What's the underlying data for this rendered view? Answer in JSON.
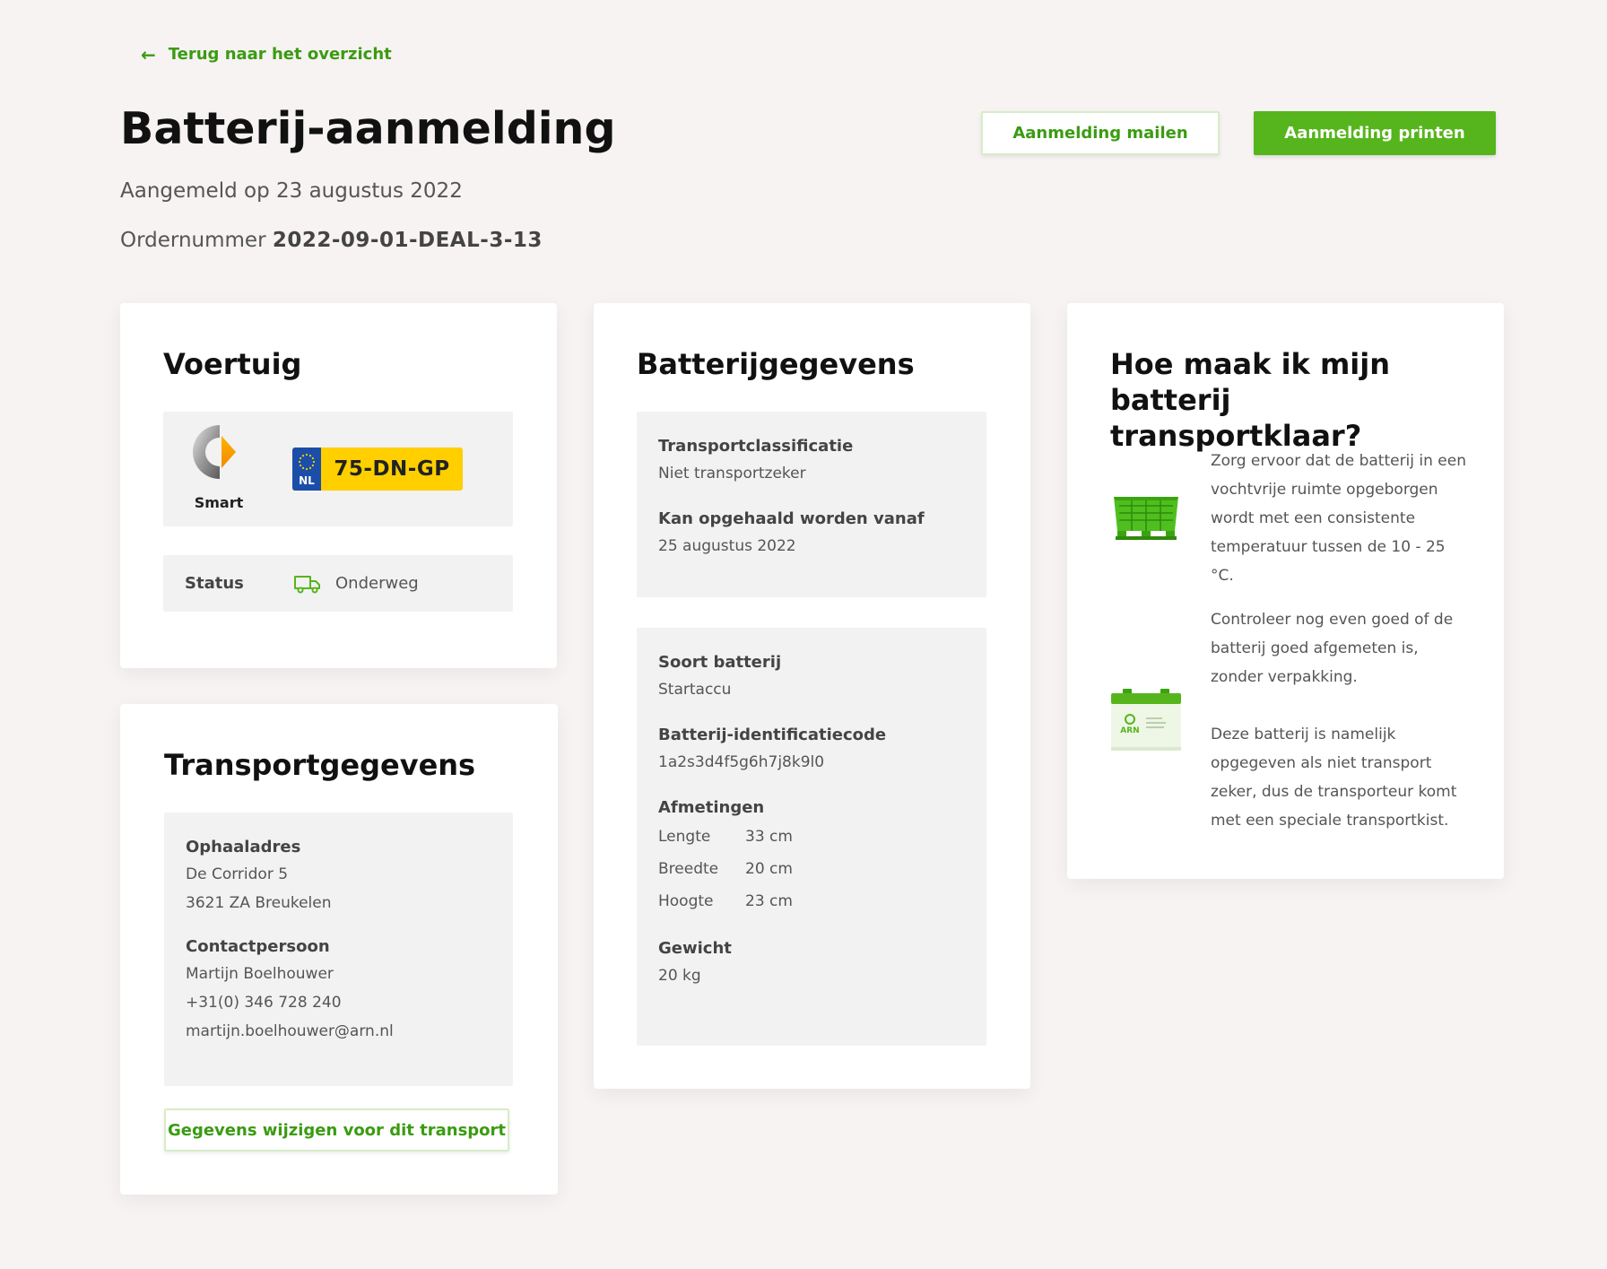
{
  "nav": {
    "back_label": "Terug naar het overzicht"
  },
  "header": {
    "title": "Batterij-aanmelding",
    "submitted": "Aangemeld op 23 augustus 2022",
    "order_label": "Ordernummer",
    "order_number": "2022-09-01-DEAL-3-13",
    "mail_button": "Aanmelding mailen",
    "print_button": "Aanmelding printen"
  },
  "vehicle": {
    "title": "Voertuig",
    "brand": "Smart",
    "plate_country": "NL",
    "plate_number": "75-DN-GP",
    "status_label": "Status",
    "status_value": "Onderweg",
    "status_icon": "truck-icon"
  },
  "transport": {
    "title": "Transportgegevens",
    "address_label": "Ophaaladres",
    "address_line1": "De Corridor 5",
    "address_line2": "3621 ZA Breukelen",
    "contact_label": "Contactpersoon",
    "contact_name": "Martijn Boelhouwer",
    "contact_phone": "+31(0) 346 728 240",
    "contact_email": "martijn.boelhouwer@arn.nl",
    "edit_button": "Gegevens wijzigen voor dit transport"
  },
  "battery": {
    "title": "Batterijgegevens",
    "classification_label": "Transportclassificatie",
    "classification_value": "Niet transportzeker",
    "pickup_label": "Kan opgehaald worden vanaf",
    "pickup_value": "25 augustus 2022",
    "type_label": "Soort batterij",
    "type_value": "Startaccu",
    "id_label": "Batterij-identificatiecode",
    "id_value": "1a2s3d4f5g6h7j8k9l0",
    "dimensions_label": "Afmetingen",
    "dimensions": [
      {
        "label": "Lengte",
        "value": "33 cm"
      },
      {
        "label": "Breedte",
        "value": "20 cm"
      },
      {
        "label": "Hoogte",
        "value": "23 cm"
      }
    ],
    "weight_label": "Gewicht",
    "weight_value": "20 kg"
  },
  "help": {
    "title": "Hoe maak ik mijn batterij transportklaar?",
    "item1": "Zorg ervoor dat de batterij in een vochtvrije ruimte opgeborgen wordt met een consistente temperatuur tussen de 10 - 25 °C.",
    "item2_p1": "Controleer nog even goed of de batterij goed afgemeten is, zonder verpakking.",
    "item2_p2": "Deze batterij is namelijk opgegeven als niet transport zeker, dus de transporteur komt met een speciale transportkist.",
    "battery_label": "ARN"
  },
  "colors": {
    "accent": "#56b51c",
    "accent_text": "#3b9b12",
    "background": "#f6f3f2",
    "panel": "#f2f2f2",
    "plate_yellow": "#ffcf00",
    "plate_blue": "#1b4ea8"
  }
}
